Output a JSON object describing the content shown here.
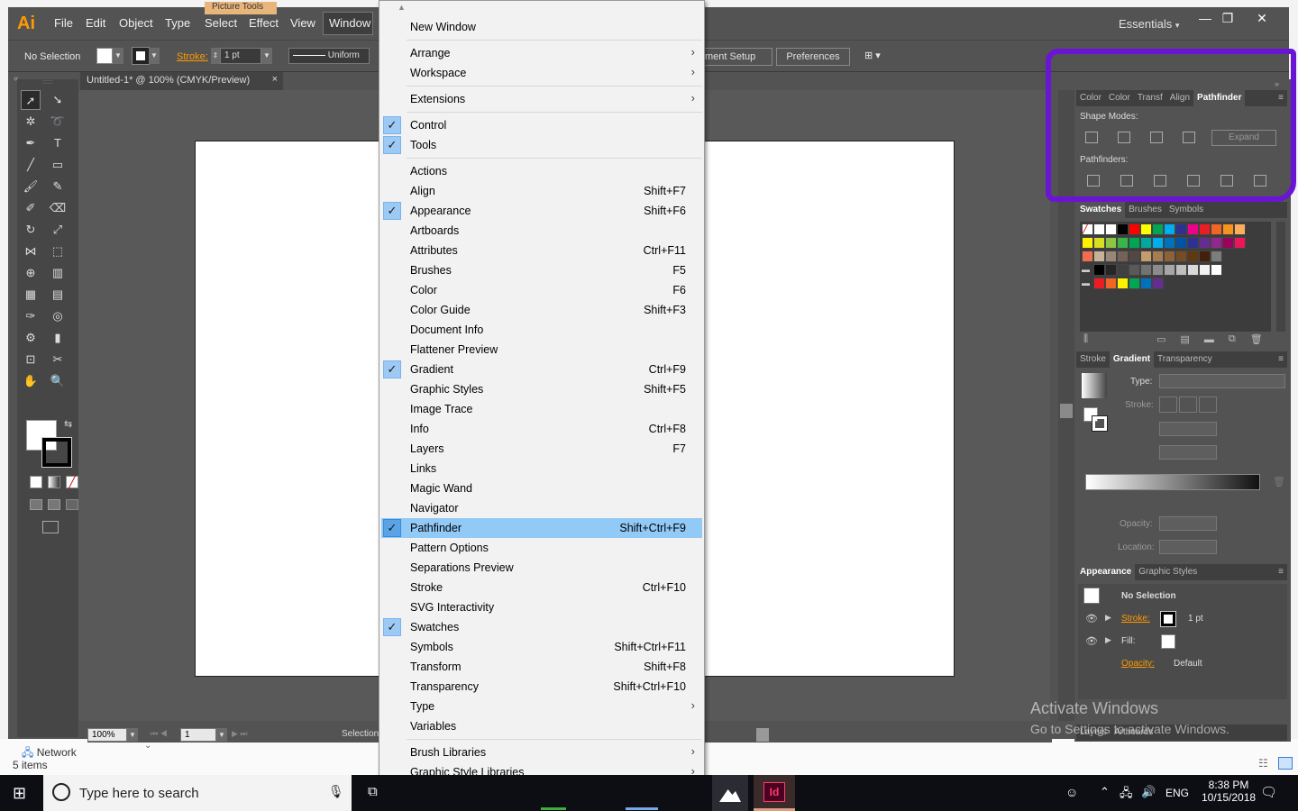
{
  "app": {
    "logo": "Ai",
    "menus": [
      "File",
      "Edit",
      "Object",
      "Type",
      "Select",
      "Effect",
      "View",
      "Window"
    ],
    "workspace": "Essentials",
    "context_tab": "Picture Tools",
    "window_controls": [
      "—",
      "❐",
      "✕"
    ]
  },
  "control_bar": {
    "selection": "No Selection",
    "stroke_label": "Stroke:",
    "stroke_value": "1 pt",
    "profile": "Uniform",
    "doc_setup": "ment Setup",
    "preferences": "Preferences"
  },
  "document": {
    "tab_title": "Untitled-1* @ 100% (CMYK/Preview)",
    "close": "×"
  },
  "status": {
    "zoom": "100%",
    "page": "1",
    "tool": "Selection"
  },
  "panels": {
    "top_tabs": [
      "Color",
      "Color",
      "Transf",
      "Align",
      "Pathfinder"
    ],
    "shape_modes": "Shape Modes:",
    "expand": "Expand",
    "pathfinders": "Pathfinders:",
    "swatch_tabs": [
      "Swatches",
      "Brushes",
      "Symbols"
    ],
    "gradient_tabs": [
      "Stroke",
      "Gradient",
      "Transparency"
    ],
    "type_label": "Type:",
    "stroke_label": "Stroke:",
    "opacity_label": "Opacity:",
    "location_label": "Location:",
    "appearance_tabs": [
      "Appearance",
      "Graphic Styles"
    ],
    "no_selection": "No Selection",
    "stroke": "Stroke:",
    "stroke_pt": "1 pt",
    "fill": "Fill:",
    "opacity": "Opacity:",
    "opacity_val": "Default",
    "bottom_tabs": [
      "Layers",
      "Artboards"
    ]
  },
  "swatch_colors": [
    [
      "#ffffff",
      "#ffffff",
      "#ffffff",
      "#000000",
      "#ff0000",
      "#ffff00",
      "#00a651",
      "#00aeef",
      "#2e3192",
      "#ec008c",
      "#ed1c24",
      "#f26522",
      "#f7941d",
      "#fbaf5d"
    ],
    [
      "#fff200",
      "#d7df23",
      "#8dc63f",
      "#39b54a",
      "#00a651",
      "#00a99d",
      "#00aeef",
      "#0072bc",
      "#0054a6",
      "#2e3192",
      "#662d91",
      "#92278f",
      "#9e005d",
      "#ed145b"
    ],
    [
      "#f26c4f",
      "#c7b299",
      "#998675",
      "#736357",
      "#534741",
      "#c69c6d",
      "#a67c52",
      "#8c6239",
      "#754c24",
      "#603913",
      "#42210b",
      "#7d7d7d"
    ],
    [
      "#000000",
      "#262626",
      "#404040",
      "#595959",
      "#737373",
      "#8c8c8c",
      "#a6a6a6",
      "#bfbfbf",
      "#d9d9d9",
      "#f2f2f2",
      "#ffffff"
    ],
    [
      "#ed1c24",
      "#f26522",
      "#fff200",
      "#00a651",
      "#0072bc",
      "#662d91"
    ]
  ],
  "menu": {
    "items": [
      {
        "label": "New Window",
        "shortcut": "",
        "check": false,
        "sub": false
      },
      {
        "sep": true
      },
      {
        "label": "Arrange",
        "shortcut": "",
        "check": false,
        "sub": true
      },
      {
        "label": "Workspace",
        "shortcut": "",
        "check": false,
        "sub": true
      },
      {
        "sep": true
      },
      {
        "label": "Extensions",
        "shortcut": "",
        "check": false,
        "sub": true
      },
      {
        "sep": true
      },
      {
        "label": "Control",
        "shortcut": "",
        "check": true,
        "sub": false
      },
      {
        "label": "Tools",
        "shortcut": "",
        "check": true,
        "sub": false
      },
      {
        "sep": true
      },
      {
        "label": "Actions",
        "shortcut": "",
        "check": false,
        "sub": false
      },
      {
        "label": "Align",
        "shortcut": "Shift+F7",
        "check": false,
        "sub": false
      },
      {
        "label": "Appearance",
        "shortcut": "Shift+F6",
        "check": true,
        "sub": false
      },
      {
        "label": "Artboards",
        "shortcut": "",
        "check": false,
        "sub": false
      },
      {
        "label": "Attributes",
        "shortcut": "Ctrl+F11",
        "check": false,
        "sub": false
      },
      {
        "label": "Brushes",
        "shortcut": "F5",
        "check": false,
        "sub": false
      },
      {
        "label": "Color",
        "shortcut": "F6",
        "check": false,
        "sub": false
      },
      {
        "label": "Color Guide",
        "shortcut": "Shift+F3",
        "check": false,
        "sub": false
      },
      {
        "label": "Document Info",
        "shortcut": "",
        "check": false,
        "sub": false
      },
      {
        "label": "Flattener Preview",
        "shortcut": "",
        "check": false,
        "sub": false
      },
      {
        "label": "Gradient",
        "shortcut": "Ctrl+F9",
        "check": true,
        "sub": false
      },
      {
        "label": "Graphic Styles",
        "shortcut": "Shift+F5",
        "check": false,
        "sub": false
      },
      {
        "label": "Image Trace",
        "shortcut": "",
        "check": false,
        "sub": false
      },
      {
        "label": "Info",
        "shortcut": "Ctrl+F8",
        "check": false,
        "sub": false
      },
      {
        "label": "Layers",
        "shortcut": "F7",
        "check": false,
        "sub": false
      },
      {
        "label": "Links",
        "shortcut": "",
        "check": false,
        "sub": false
      },
      {
        "label": "Magic Wand",
        "shortcut": "",
        "check": false,
        "sub": false
      },
      {
        "label": "Navigator",
        "shortcut": "",
        "check": false,
        "sub": false
      },
      {
        "label": "Pathfinder",
        "shortcut": "Shift+Ctrl+F9",
        "check": true,
        "sub": false,
        "highlight": true
      },
      {
        "label": "Pattern Options",
        "shortcut": "",
        "check": false,
        "sub": false
      },
      {
        "label": "Separations Preview",
        "shortcut": "",
        "check": false,
        "sub": false
      },
      {
        "label": "Stroke",
        "shortcut": "Ctrl+F10",
        "check": false,
        "sub": false
      },
      {
        "label": "SVG Interactivity",
        "shortcut": "",
        "check": false,
        "sub": false
      },
      {
        "label": "Swatches",
        "shortcut": "",
        "check": true,
        "sub": false
      },
      {
        "label": "Symbols",
        "shortcut": "Shift+Ctrl+F11",
        "check": false,
        "sub": false
      },
      {
        "label": "Transform",
        "shortcut": "Shift+F8",
        "check": false,
        "sub": false
      },
      {
        "label": "Transparency",
        "shortcut": "Shift+Ctrl+F10",
        "check": false,
        "sub": false
      },
      {
        "label": "Type",
        "shortcut": "",
        "check": false,
        "sub": true
      },
      {
        "label": "Variables",
        "shortcut": "",
        "check": false,
        "sub": false
      },
      {
        "sep": true
      },
      {
        "label": "Brush Libraries",
        "shortcut": "",
        "check": false,
        "sub": true
      },
      {
        "label": "Graphic Style Libraries",
        "shortcut": "",
        "check": false,
        "sub": true
      }
    ]
  },
  "explorer": {
    "network": "Network",
    "items": "5 items"
  },
  "taskbar": {
    "search_placeholder": "Type here to search",
    "lang": "ENG",
    "time": "8:38 PM",
    "date": "10/15/2018",
    "id_label": "Id"
  },
  "watermark": {
    "line1": "Activate Windows",
    "line2": "Go to Settings to activate Windows."
  },
  "colors": {
    "accent_ai": "#ff9a00",
    "highlight_purple": "#6a14d6",
    "menu_highlight": "#91c9f7"
  }
}
